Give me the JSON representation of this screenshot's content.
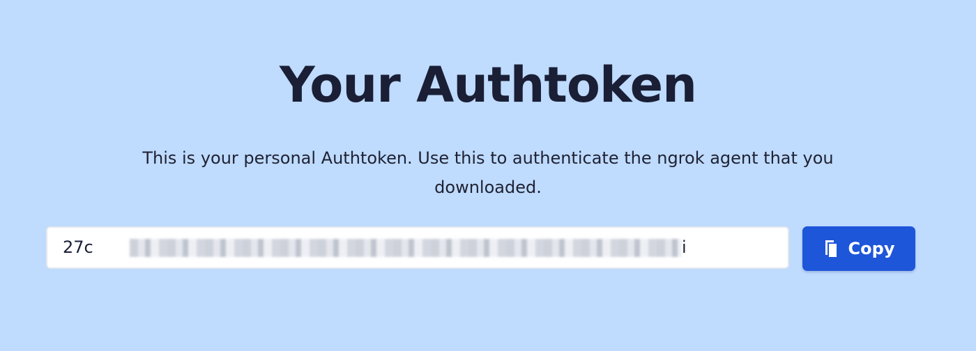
{
  "page": {
    "title": "Your Authtoken",
    "description": "This is your personal Authtoken. Use this to authenticate the ngrok agent that you downloaded."
  },
  "token": {
    "visible_prefix": "27c",
    "visible_suffix": "i"
  },
  "copy_button": {
    "label": "Copy",
    "icon": "copy-icon"
  },
  "colors": {
    "background": "#bfdbfe",
    "accent": "#1e56d9",
    "text": "#1a1f36"
  }
}
